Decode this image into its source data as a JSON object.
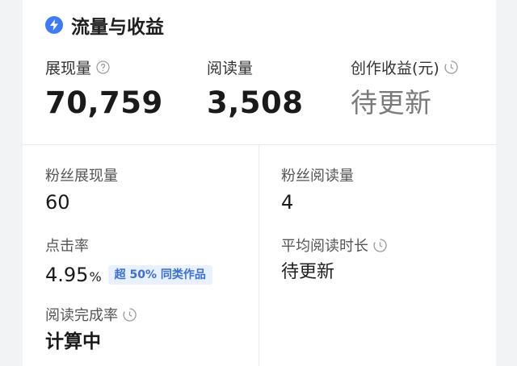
{
  "header": {
    "title": "流量与收益",
    "icon": "lightning-icon"
  },
  "top_metrics": [
    {
      "label": "展现量",
      "value": "70,759",
      "icon": "question-circle-icon"
    },
    {
      "label": "阅读量",
      "value": "3,508"
    },
    {
      "label": "创作收益(元)",
      "value": "待更新",
      "icon": "clock-icon"
    }
  ],
  "metrics": {
    "fans_impressions": {
      "label": "粉丝展现量",
      "value": "60"
    },
    "fans_reads": {
      "label": "粉丝阅读量",
      "value": "4"
    },
    "ctr": {
      "label": "点击率",
      "value": "4.95",
      "unit": "%",
      "badge": "超 50% 同类作品"
    },
    "avg_read_time": {
      "label": "平均阅读时长",
      "value": "待更新",
      "icon": "clock-icon"
    },
    "completion_rate": {
      "label": "阅读完成率",
      "value": "计算中",
      "icon": "clock-icon"
    }
  },
  "colors": {
    "accent": "#3f7bf5",
    "badge_bg": "#eaf1fe",
    "badge_text": "#3a6fd8",
    "pending": "#7a7a7a"
  }
}
